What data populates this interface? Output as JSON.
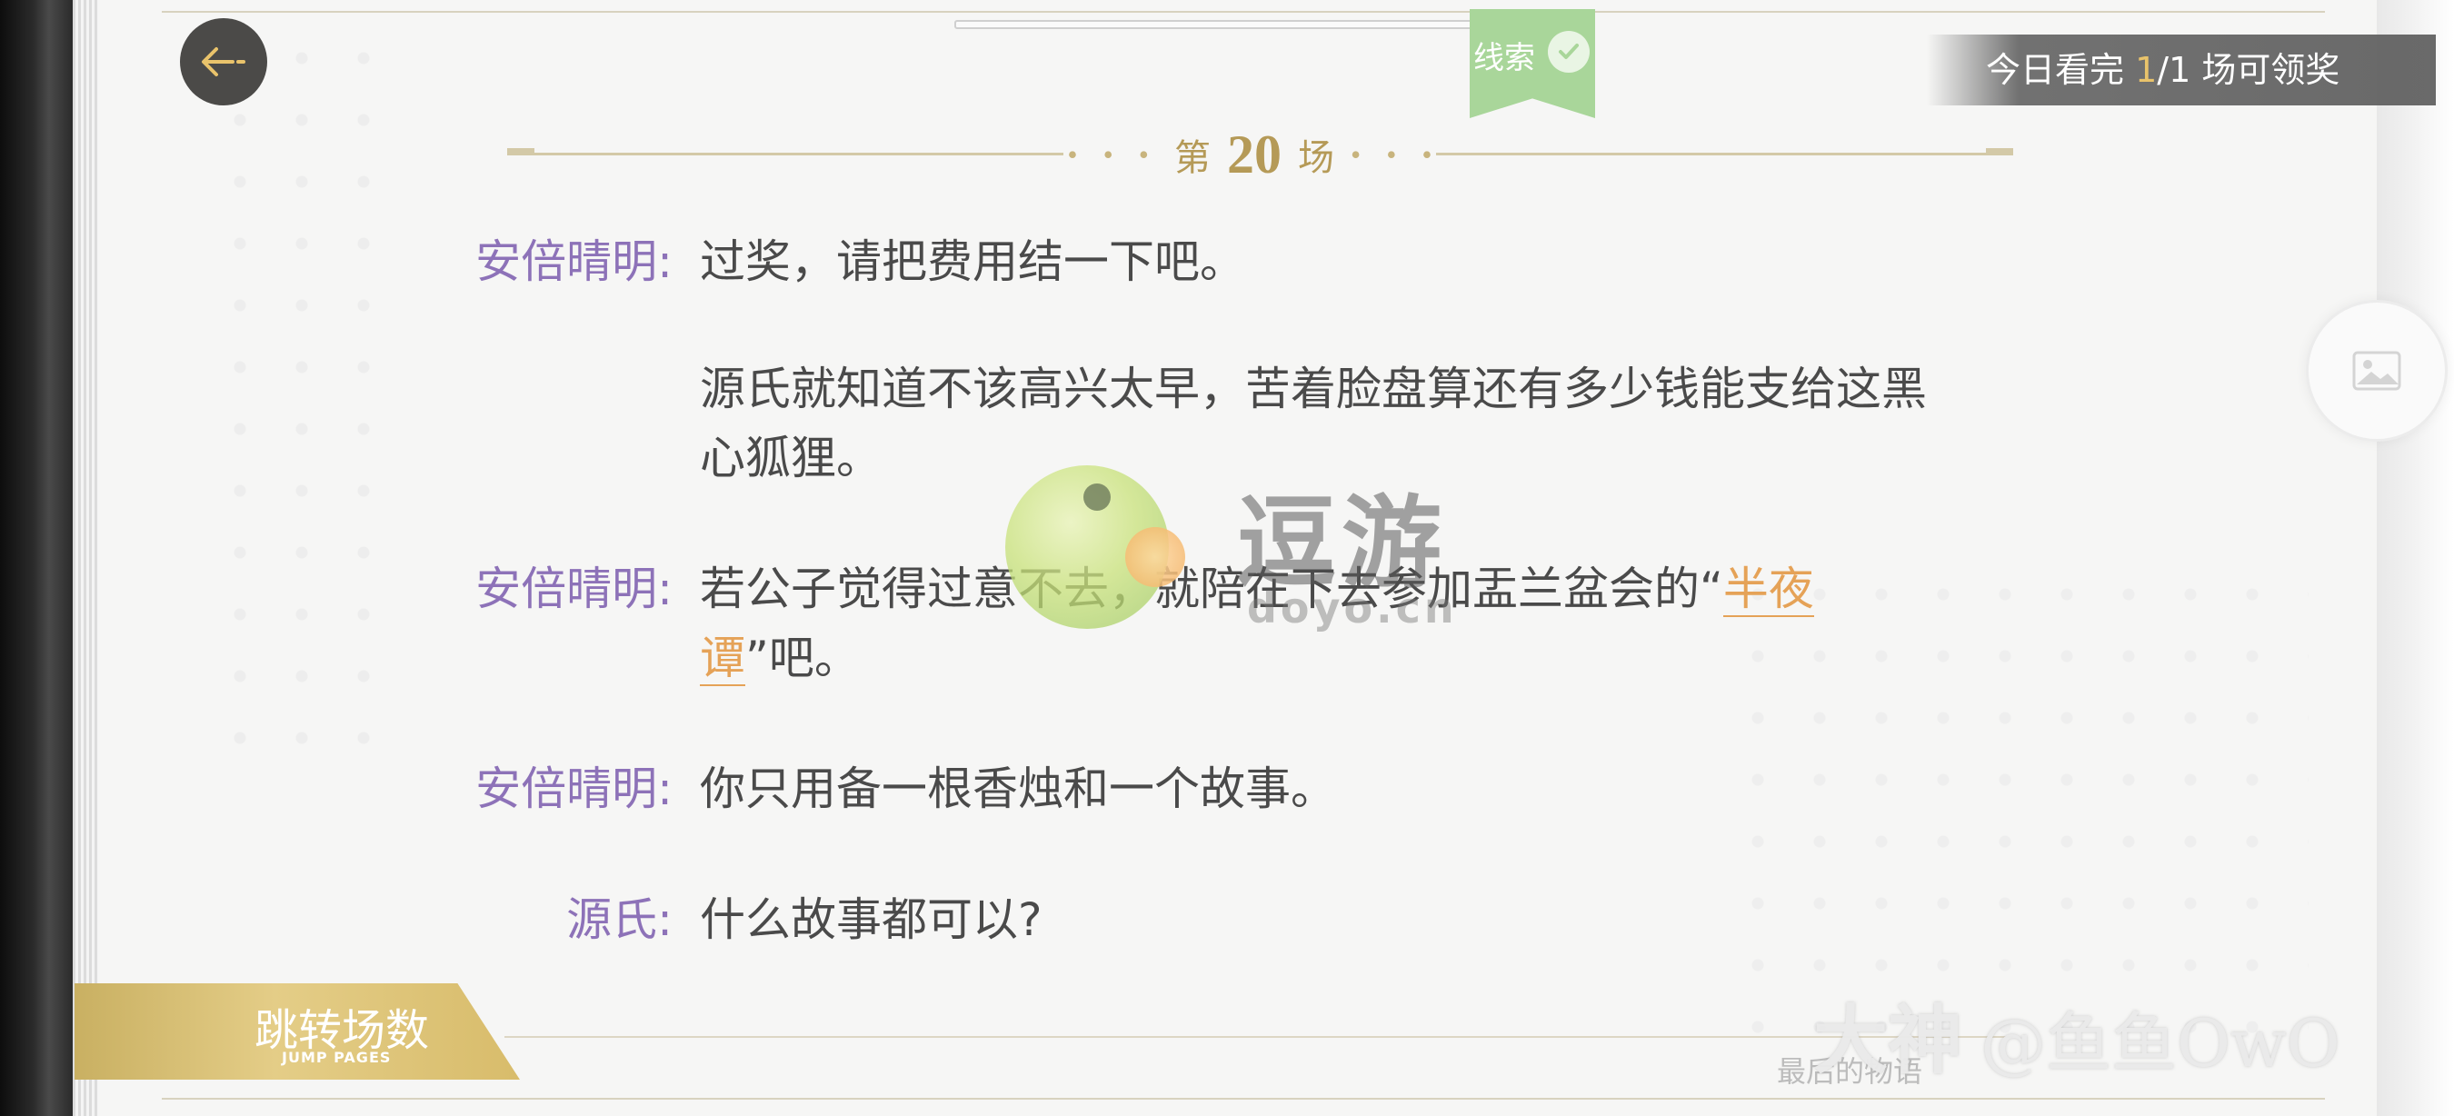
{
  "header": {
    "clue_label": "线索",
    "reward": {
      "prefix": "今日看完 ",
      "current": "1",
      "suffix": "/1 场可领奖"
    },
    "scene": {
      "prefix": "第",
      "number": "20",
      "suffix": "场",
      "dots": "• • •"
    }
  },
  "dialogue": [
    {
      "speaker": "安倍晴明:",
      "text": "过奖，请把费用结一下吧。"
    },
    {
      "speaker": "",
      "text": "源氏就知道不该高兴太早，苦着脸盘算还有多少钱能支给这黑心狐狸。"
    },
    {
      "speaker": "安倍晴明:",
      "text_before": "若公子觉得过意不去，就陪在下去参加盂兰盆会的“",
      "highlight": "半夜谭",
      "text_after": "”吧。"
    },
    {
      "speaker": "安倍晴明:",
      "text": "你只用备一根香烛和一个故事。"
    },
    {
      "speaker": "源氏:",
      "text": "什么故事都可以?"
    }
  ],
  "watermark": {
    "title": "逗游",
    "sub": "doyo.cn"
  },
  "footer": {
    "jump_label": "跳转场数",
    "jump_sub": "JUMP PAGES",
    "hint": "最后的物语",
    "signature": "大神",
    "handle": "@鱼鱼OwO"
  },
  "colors": {
    "speaker": "#8d72b8",
    "highlight": "#e5a257",
    "gold": "#b59a57",
    "clue_green": "#a9d69a"
  },
  "icons": {
    "back": "back-arrow-icon",
    "clue_check": "check-icon",
    "gallery": "image-icon"
  }
}
